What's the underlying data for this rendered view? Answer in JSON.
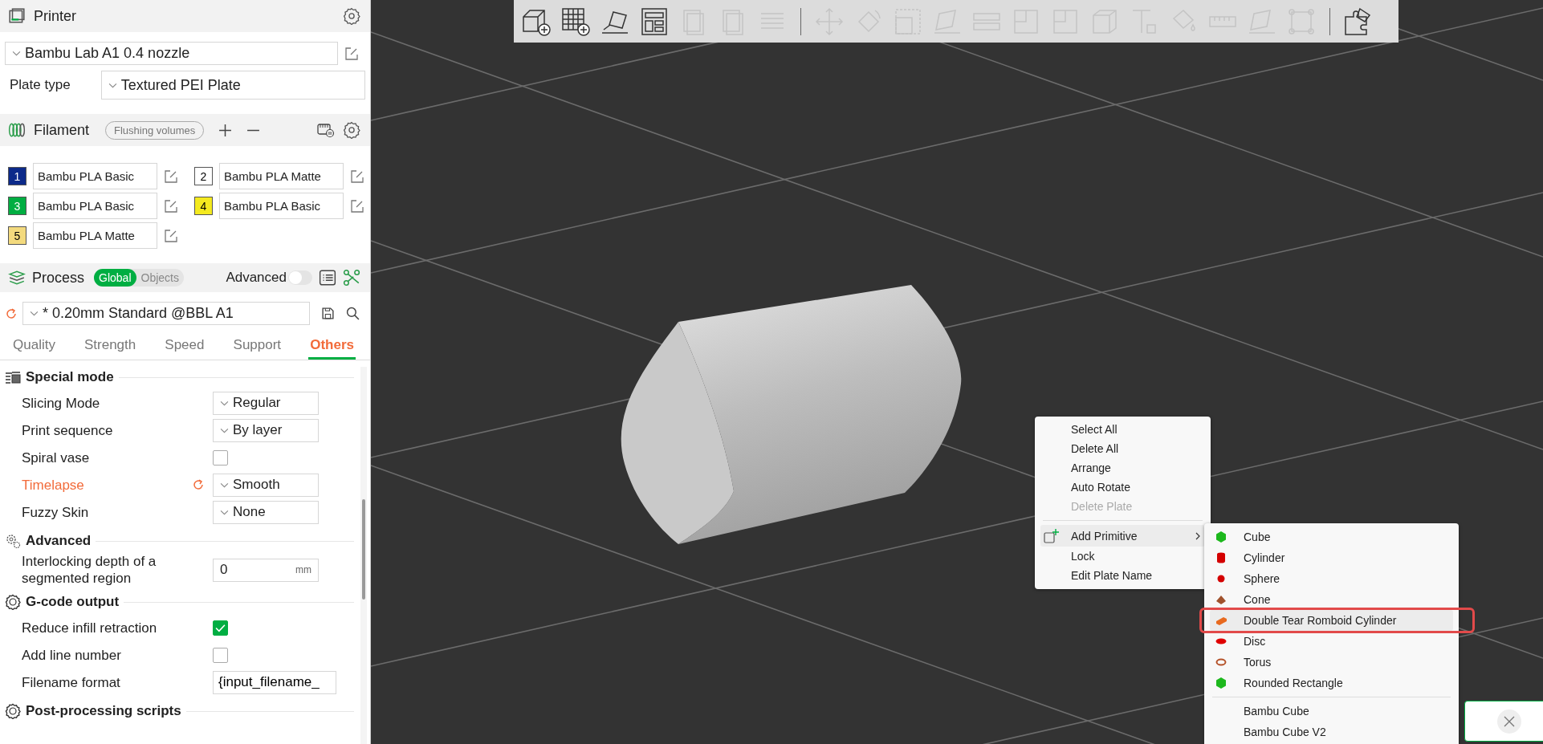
{
  "printer": {
    "title": "Printer",
    "preset": "Bambu Lab A1 0.4 nozzle",
    "plate_type_label": "Plate type",
    "plate_type": "Textured PEI Plate"
  },
  "filament": {
    "title": "Filament",
    "flushing_button": "Flushing volumes",
    "slots": [
      {
        "number": "1",
        "color": "#0c2a8a",
        "name": "Bambu PLA Basic"
      },
      {
        "number": "2",
        "color": "#ffffff",
        "name": "Bambu PLA Matte"
      },
      {
        "number": "3",
        "color": "#00ae42",
        "name": "Bambu PLA Basic"
      },
      {
        "number": "4",
        "color": "#f4ea1f",
        "name": "Bambu PLA Basic"
      },
      {
        "number": "5",
        "color": "#f3da7e",
        "name": "Bambu PLA Matte"
      }
    ]
  },
  "process": {
    "title": "Process",
    "modes": [
      {
        "label": "Global",
        "selected": true
      },
      {
        "label": "Objects",
        "selected": false
      }
    ],
    "advanced": {
      "label": "Advanced",
      "on": false
    },
    "preset": "* 0.20mm Standard @BBL A1",
    "preset_modified": true,
    "tabs": [
      {
        "label": "Quality",
        "selected": false
      },
      {
        "label": "Strength",
        "selected": false
      },
      {
        "label": "Speed",
        "selected": false
      },
      {
        "label": "Support",
        "selected": false
      },
      {
        "label": "Others",
        "selected": true
      }
    ],
    "sections": [
      {
        "title": "Special mode",
        "kind": "special",
        "rows": [
          {
            "kind": "select",
            "label": "Slicing Mode",
            "value": "Regular",
            "modified": false
          },
          {
            "kind": "select",
            "label": "Print sequence",
            "value": "By layer",
            "modified": false
          },
          {
            "kind": "checkbox",
            "label": "Spiral vase",
            "checked": false,
            "modified": false
          },
          {
            "kind": "select",
            "label": "Timelapse",
            "value": "Smooth",
            "modified": true
          },
          {
            "kind": "select",
            "label": "Fuzzy Skin",
            "value": "None",
            "modified": false
          }
        ]
      },
      {
        "title": "Advanced",
        "kind": "advanced",
        "rows": [
          {
            "kind": "number",
            "label": "Interlocking depth of a segmented region",
            "value": "0",
            "unit": "mm",
            "modified": false
          }
        ]
      },
      {
        "title": "G-code output",
        "kind": "gcode",
        "rows": [
          {
            "kind": "checkbox",
            "label": "Reduce infill retraction",
            "checked": true,
            "modified": false
          },
          {
            "kind": "checkbox",
            "label": "Add line number",
            "checked": false,
            "modified": false
          },
          {
            "kind": "text",
            "label": "Filename format",
            "value": "{input_filename_",
            "modified": false
          }
        ]
      },
      {
        "title": "Post-processing scripts",
        "kind": "gcode"
      }
    ]
  },
  "toolbar": {
    "groups": [
      [
        {
          "kind": "add-cube",
          "disabled": false
        },
        {
          "kind": "add-plate",
          "disabled": false
        },
        {
          "kind": "auto-orient",
          "disabled": false
        },
        {
          "kind": "arrange",
          "disabled": false
        },
        {
          "kind": "copy",
          "disabled": true
        },
        {
          "kind": "paste",
          "disabled": true
        },
        {
          "kind": "list",
          "disabled": true
        }
      ],
      [
        {
          "kind": "move",
          "disabled": true
        },
        {
          "kind": "rotate",
          "disabled": true
        },
        {
          "kind": "scale",
          "disabled": true
        },
        {
          "kind": "lay-flat",
          "disabled": true
        },
        {
          "kind": "cut",
          "disabled": true
        },
        {
          "kind": "panel",
          "disabled": true
        },
        {
          "kind": "panel",
          "disabled": true
        },
        {
          "kind": "box",
          "disabled": true
        },
        {
          "kind": "text",
          "disabled": true
        },
        {
          "kind": "paint",
          "disabled": true
        },
        {
          "kind": "ruler",
          "disabled": true
        },
        {
          "kind": "lay-flat",
          "disabled": true
        },
        {
          "kind": "frame",
          "disabled": true
        }
      ],
      [
        {
          "kind": "assembly",
          "disabled": false
        }
      ]
    ]
  },
  "context_menu": {
    "groups": [
      [
        {
          "label": "Select All",
          "disabled": false,
          "selected": false,
          "submenu": false
        },
        {
          "label": "Delete All",
          "disabled": false,
          "selected": false,
          "submenu": false
        },
        {
          "label": "Arrange",
          "disabled": false,
          "selected": false,
          "submenu": false
        },
        {
          "label": "Auto Rotate",
          "disabled": false,
          "selected": false,
          "submenu": false
        },
        {
          "label": "Delete Plate",
          "disabled": true,
          "selected": false,
          "submenu": false
        }
      ],
      [
        {
          "label": "Add Primitive",
          "disabled": false,
          "selected": true,
          "submenu": true
        },
        {
          "label": "Lock",
          "disabled": false,
          "selected": false,
          "submenu": false
        },
        {
          "label": "Edit Plate Name",
          "disabled": false,
          "selected": false,
          "submenu": false
        }
      ]
    ]
  },
  "submenu": {
    "groups": [
      [
        {
          "label": "Cube",
          "kind": "cube",
          "color": "#1db81d",
          "selected": false,
          "annotated": false
        },
        {
          "label": "Cylinder",
          "kind": "cylinder",
          "color": "#d40000",
          "selected": false,
          "annotated": false
        },
        {
          "label": "Sphere",
          "kind": "sphere",
          "color": "#d40000",
          "selected": false,
          "annotated": false
        },
        {
          "label": "Cone",
          "kind": "cone",
          "color": "#a0522d",
          "selected": false,
          "annotated": false
        },
        {
          "label": "Double Tear Romboid Cylinder",
          "kind": "double-tear",
          "color": "#e86a1f",
          "selected": true,
          "annotated": true
        },
        {
          "label": "Disc",
          "kind": "disc",
          "color": "#e00000",
          "selected": false,
          "annotated": false
        },
        {
          "label": "Torus",
          "kind": "torus",
          "color": "#b5532a",
          "selected": false,
          "annotated": false
        },
        {
          "label": "Rounded Rectangle",
          "kind": "cube",
          "color": "#1db81d",
          "selected": false,
          "annotated": false
        }
      ],
      [
        {
          "label": "Bambu Cube",
          "kind": "model",
          "selected": false,
          "annotated": false
        },
        {
          "label": "Bambu Cube V2",
          "kind": "model",
          "selected": false,
          "annotated": false
        }
      ]
    ]
  }
}
